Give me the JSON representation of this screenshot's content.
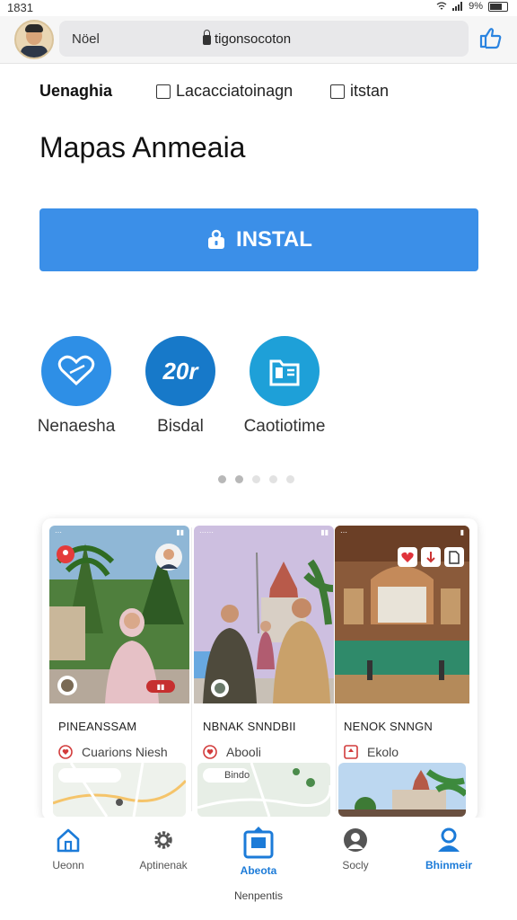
{
  "status": {
    "time": "1831",
    "battery": "9%"
  },
  "header": {
    "url_left": "Nöel",
    "url_domain": "tigonsocoton"
  },
  "filters": {
    "title": "Uenaghia",
    "options": [
      {
        "label": "Lacacciatoinagn",
        "checked": false
      },
      {
        "label": "itstan",
        "checked": false
      }
    ]
  },
  "page_title": "Mapas Anmeaia",
  "install_label": "INSTAL",
  "features": [
    {
      "label": "Nenaesha",
      "icon": "heart-icon",
      "color": "#2e8fe6"
    },
    {
      "label": "Bisdal",
      "icon": "badge-20r-icon",
      "text": "20r",
      "color": "#1779c9"
    },
    {
      "label": "Caotiotime",
      "icon": "folder-icon",
      "color": "#1ea0d8"
    }
  ],
  "carousel": {
    "count": 5,
    "active": 1
  },
  "cards": [
    {
      "title": "PINEANSSAM",
      "location": "Cuarions Niesh",
      "thumb_label": ""
    },
    {
      "title": "NBNAK SNNDBII",
      "location": "Abooli",
      "thumb_label": "Bindo"
    },
    {
      "title": "NENOK SNNGN",
      "location": "Ekolo",
      "thumb_label": ""
    }
  ],
  "nav": [
    {
      "label": "Ueonn",
      "icon": "home-icon",
      "active": false
    },
    {
      "label": "Aptinenak",
      "icon": "gear-icon",
      "active": false
    },
    {
      "label": "Abeota",
      "icon": "calendar-icon",
      "active": true
    },
    {
      "label": "Socly",
      "icon": "user-icon",
      "active": false
    },
    {
      "label": "Bhinmeir",
      "icon": "profile-icon",
      "active": true
    }
  ],
  "footer": "Nenpentis",
  "colors": {
    "accent": "#3b8fe8",
    "nav_active": "#1c7bd8"
  }
}
